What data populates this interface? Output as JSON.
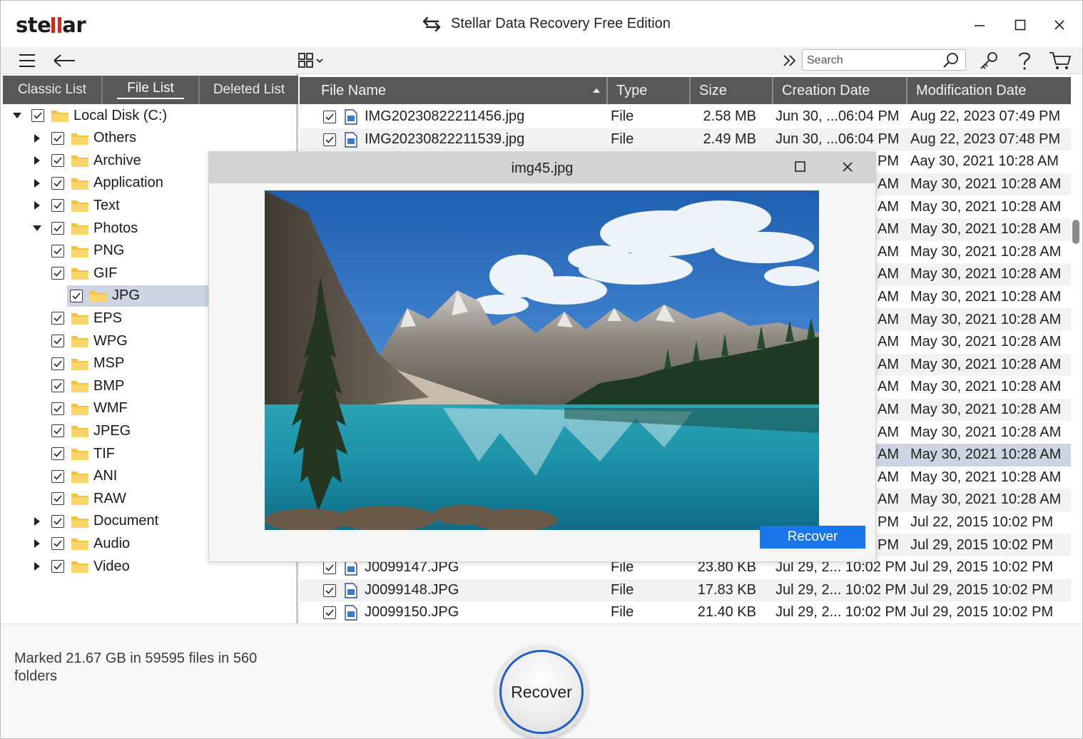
{
  "window": {
    "logo": "stellar",
    "title": "Stellar Data Recovery Free Edition",
    "minimize_label": "—",
    "maximize_label": "☐",
    "close_label": "✕"
  },
  "toolbar": {
    "search_placeholder": "Search"
  },
  "left_tabs": [
    {
      "label": "Classic List"
    },
    {
      "label": "File List"
    },
    {
      "label": "Deleted List"
    }
  ],
  "tree": {
    "root": "Local Disk (C:)",
    "items": [
      "Others",
      "Archive",
      "Application",
      "Text",
      "Photos"
    ],
    "photos": [
      "PNG",
      "GIF",
      "JPG",
      "EPS",
      "WPG",
      "MSP",
      "BMP",
      "WMF",
      "JPEG",
      "TIF",
      "ANI",
      "RAW"
    ],
    "after": [
      "Document",
      "Audio",
      "Video"
    ]
  },
  "columns": [
    "File Name",
    "Type",
    "Size",
    "Creation Date",
    "Modification Date"
  ],
  "files": [
    {
      "name": "IMG20230822211456.jpg",
      "type": "File",
      "size": "2.58 MB",
      "created": "Jun 30, ...06:04 PM",
      "modified": "Aug 22, 2023 07:49 PM"
    },
    {
      "name": "IMG20230822211539.jpg",
      "type": "File",
      "size": "2.49 MB",
      "created": "Jun 30, ...06:04 PM",
      "modified": "Aug 22, 2023 07:48 PM"
    },
    {
      "created": "PM",
      "modified": "Aay 30, 2021 10:28 AM"
    },
    {
      "created": "AM",
      "modified": "May 30, 2021 10:28 AM"
    },
    {
      "created": "AM",
      "modified": "May 30, 2021 10:28 AM"
    },
    {
      "created": "AM",
      "modified": "May 30, 2021 10:28 AM"
    },
    {
      "created": "AM",
      "modified": "May 30, 2021 10:28 AM"
    },
    {
      "created": "AM",
      "modified": "May 30, 2021 10:28 AM"
    },
    {
      "created": "AM",
      "modified": "May 30, 2021 10:28 AM"
    },
    {
      "created": "AM",
      "modified": "May 30, 2021 10:28 AM"
    },
    {
      "created": "AM",
      "modified": "May 30, 2021 10:28 AM"
    },
    {
      "created": "AM",
      "modified": "May 30, 2021 10:28 AM"
    },
    {
      "created": "AM",
      "modified": "May 30, 2021 10:28 AM"
    },
    {
      "created": "AM",
      "modified": "May 30, 2021 10:28 AM"
    },
    {
      "created": "AM",
      "modified": "May 30, 2021 10:28 AM"
    },
    {
      "created": "AM",
      "modified": "May 30, 2021 10:28 AM"
    },
    {
      "created": "AM",
      "modified": "May 30, 2021 10:28 AM"
    },
    {
      "created": "AM",
      "modified": "May 30, 2021 10:28 AM"
    },
    {
      "created": "PM",
      "modified": "Jul 22, 2015 10:02 PM"
    },
    {
      "created": "PM",
      "modified": "Jul 29, 2015 10:02 PM"
    },
    {
      "name": "J0099147.JPG",
      "type": "File",
      "size": "23.80 KB",
      "created": "Jul 29, 2... 10:02 PM",
      "modified": "Jul 29, 2015 10:02 PM"
    },
    {
      "name": "J0099148.JPG",
      "type": "File",
      "size": "17.83 KB",
      "created": "Jul 29, 2... 10:02 PM",
      "modified": "Jul 29, 2015 10:02 PM"
    },
    {
      "name": "J0099150.JPG",
      "type": "File",
      "size": "21.40 KB",
      "created": "Jul 29, 2... 10:02 PM",
      "modified": "Jul 29, 2015 10:02 PM"
    }
  ],
  "preview": {
    "title": "img45.jpg",
    "recover_label": "Recover"
  },
  "status": {
    "text": "Marked 21.67 GB in 59595 files in 560 folders",
    "recover_label": "Recover"
  },
  "colors": {
    "header_gray": "#585858",
    "selection": "#cdd5e2",
    "accent_blue": "#1a75e8",
    "logo_red": "#e2231a",
    "folder_yellow": "#f5c342"
  }
}
